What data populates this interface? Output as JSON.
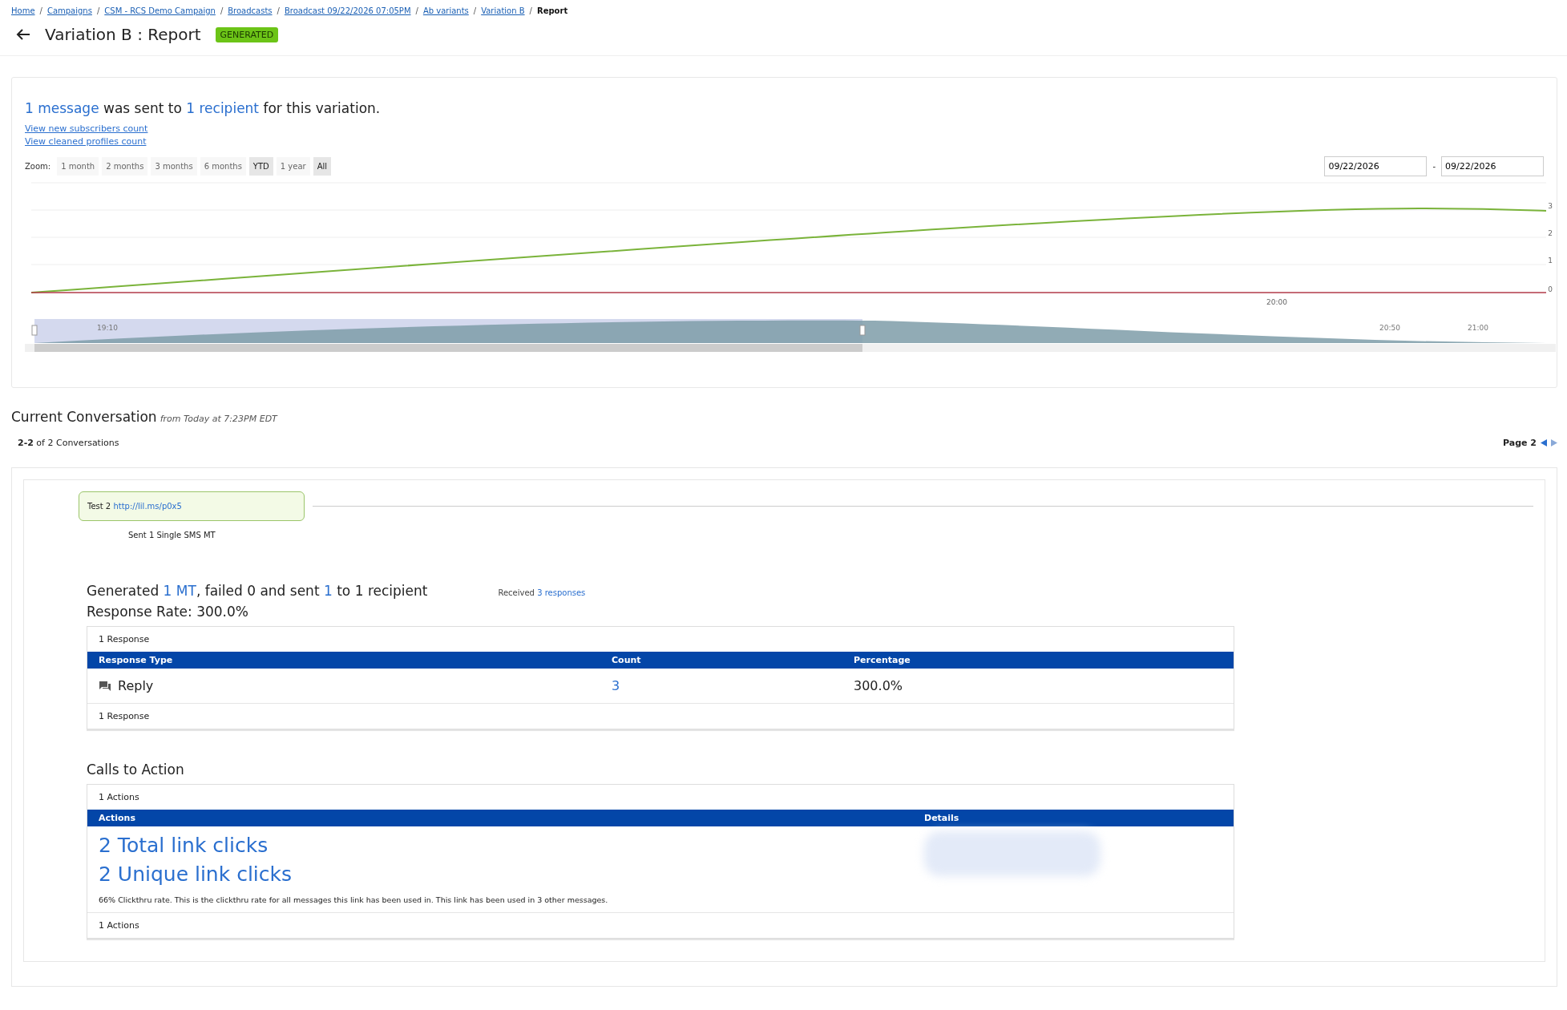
{
  "breadcrumb_separator": "/",
  "breadcrumbs": [
    {
      "label": "Home",
      "current": false
    },
    {
      "label": "Campaigns",
      "current": false
    },
    {
      "label": "CSM - RCS Demo Campaign",
      "current": false
    },
    {
      "label": "Broadcasts",
      "current": false
    },
    {
      "label": "Broadcast 09/22/2026 07:05PM",
      "current": false
    },
    {
      "label": "Ab variants",
      "current": false
    },
    {
      "label": "Variation B",
      "current": false
    },
    {
      "label": "Report",
      "current": true
    }
  ],
  "header": {
    "title": "Variation B : Report",
    "status": "GENERATED"
  },
  "summary": {
    "parts": [
      {
        "kind": "link",
        "text": "1 message"
      },
      {
        "kind": "text",
        "text": " was sent to "
      },
      {
        "kind": "link",
        "text": "1 recipient"
      },
      {
        "kind": "text",
        "text": " for this variation."
      }
    ],
    "links": [
      "View new subscribers count",
      "View cleaned profiles count"
    ]
  },
  "zoom": {
    "label": "Zoom:",
    "options": [
      {
        "label": "1 month",
        "selected": false
      },
      {
        "label": "2 months",
        "selected": false
      },
      {
        "label": "3 months",
        "selected": false
      },
      {
        "label": "6 months",
        "selected": false
      },
      {
        "label": "YTD",
        "selected": true
      },
      {
        "label": "1 year",
        "selected": false
      },
      {
        "label": "All",
        "selected": true
      }
    ]
  },
  "date_range": {
    "from": "09/22/2026",
    "separator": "-",
    "to": "09/22/2026"
  },
  "chart": {
    "y_tick_labels": [
      "3",
      "2",
      "1",
      "0"
    ],
    "x_tick_labels": [
      "20:00"
    ],
    "navigator_labels": [
      "19:10",
      "20:50",
      "21:00"
    ]
  },
  "conversation": {
    "heading": "Current Conversation",
    "subtitle": "from Today at 7:23PM EDT",
    "count": "**2-2** of 2 Conversations",
    "page": "Page 2",
    "message": {
      "text": "Test 2",
      "link": "http://lil.ms/p0x5",
      "status": "Sent 1 Single SMS MT"
    },
    "stats": {
      "parts": [
        {
          "kind": "text",
          "text": "Generated "
        },
        {
          "kind": "link",
          "text": "1 MT"
        },
        {
          "kind": "text",
          "text": ", failed 0 and sent "
        },
        {
          "kind": "link",
          "text": "1"
        },
        {
          "kind": "text",
          "text": " to 1 recipient"
        }
      ],
      "received": [
        {
          "kind": "text",
          "text": "Received "
        },
        {
          "kind": "link",
          "text": "3 responses"
        }
      ],
      "response_rate": "Response Rate: 300.0%"
    },
    "responses": {
      "caption": "1 Response",
      "columns": [
        "Response Type",
        "Count",
        "Percentage"
      ],
      "rows": [
        {
          "type": "Reply",
          "count": "3",
          "percentage": "300.0%"
        }
      ],
      "footer": "1 Response"
    },
    "calls_to_action": {
      "heading": "Calls to Action",
      "caption": "1 Actions",
      "columns": [
        "Actions",
        "Details"
      ],
      "total_clicks": "2 Total link clicks",
      "unique_clicks": "2 Unique link clicks",
      "note": "66% Clickthru rate. This is the clickthru rate for all messages this link has been used in. This link has been used in 3 other messages.",
      "footer": "1 Actions"
    }
  }
}
